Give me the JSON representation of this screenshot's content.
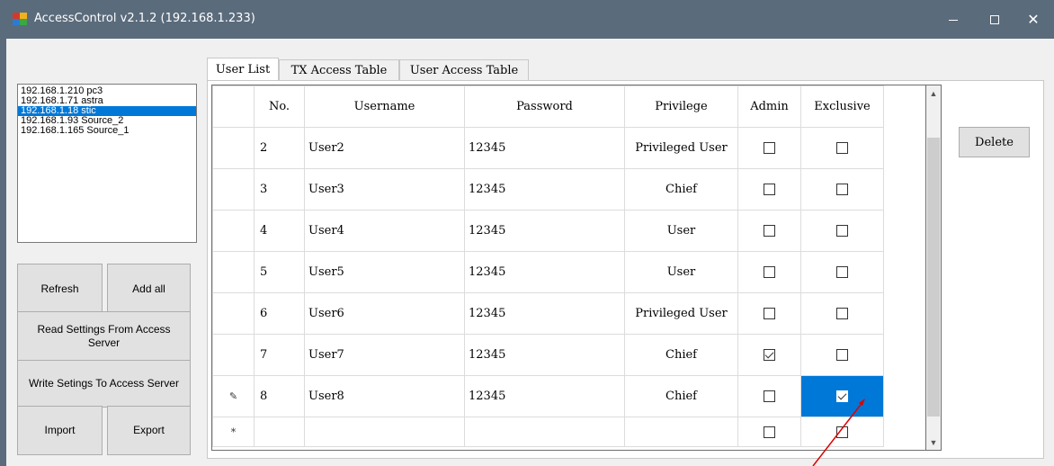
{
  "window": {
    "title": "AccessControl v2.1.2 (192.168.1.233)",
    "icon": "app-icon",
    "controls": [
      "minimize-icon",
      "maximize-icon",
      "close-icon"
    ]
  },
  "server_list": {
    "items": [
      "192.168.1.210 pc3",
      "192.168.1.71 astra",
      "192.168.1.18 stic",
      "192.168.1.93 Source_2",
      "192.168.1.165 Source_1"
    ],
    "selected_index": 2
  },
  "buttons": {
    "refresh": "Refresh",
    "add_all": "Add all",
    "read_settings": "Read Settings From Access Server",
    "write_settings": "Write Setings To Access Server",
    "import": "Import",
    "export": "Export",
    "delete": "Delete"
  },
  "tabs": [
    {
      "label": "User List",
      "active": true
    },
    {
      "label": "TX Access Table",
      "active": false
    },
    {
      "label": "User Access Table",
      "active": false
    }
  ],
  "grid": {
    "columns": [
      "No.",
      "Username",
      "Password",
      "Privilege",
      "Admin",
      "Exclusive"
    ],
    "rows": [
      {
        "no": "2",
        "username": "User2",
        "password": "12345",
        "privilege": "Privileged User",
        "admin": false,
        "exclusive": false
      },
      {
        "no": "3",
        "username": "User3",
        "password": "12345",
        "privilege": "Chief",
        "admin": false,
        "exclusive": false
      },
      {
        "no": "4",
        "username": "User4",
        "password": "12345",
        "privilege": "User",
        "admin": false,
        "exclusive": false
      },
      {
        "no": "5",
        "username": "User5",
        "password": "12345",
        "privilege": "User",
        "admin": false,
        "exclusive": false
      },
      {
        "no": "6",
        "username": "User6",
        "password": "12345",
        "privilege": "Privileged User",
        "admin": false,
        "exclusive": false
      },
      {
        "no": "7",
        "username": "User7",
        "password": "12345",
        "privilege": "Chief",
        "admin": true,
        "exclusive": false
      },
      {
        "no": "8",
        "username": "User8",
        "password": "12345",
        "privilege": "Chief",
        "admin": false,
        "exclusive": true,
        "editing": true,
        "exclusive_selected": true
      }
    ],
    "new_row": {
      "admin": false,
      "exclusive": false
    },
    "row_header_editing_glyph": "✎",
    "row_header_new_glyph": "*"
  },
  "colors": {
    "titlebar": "#5a6b7c",
    "selection": "#0078d7",
    "annotation_arrow": "#e00000"
  }
}
